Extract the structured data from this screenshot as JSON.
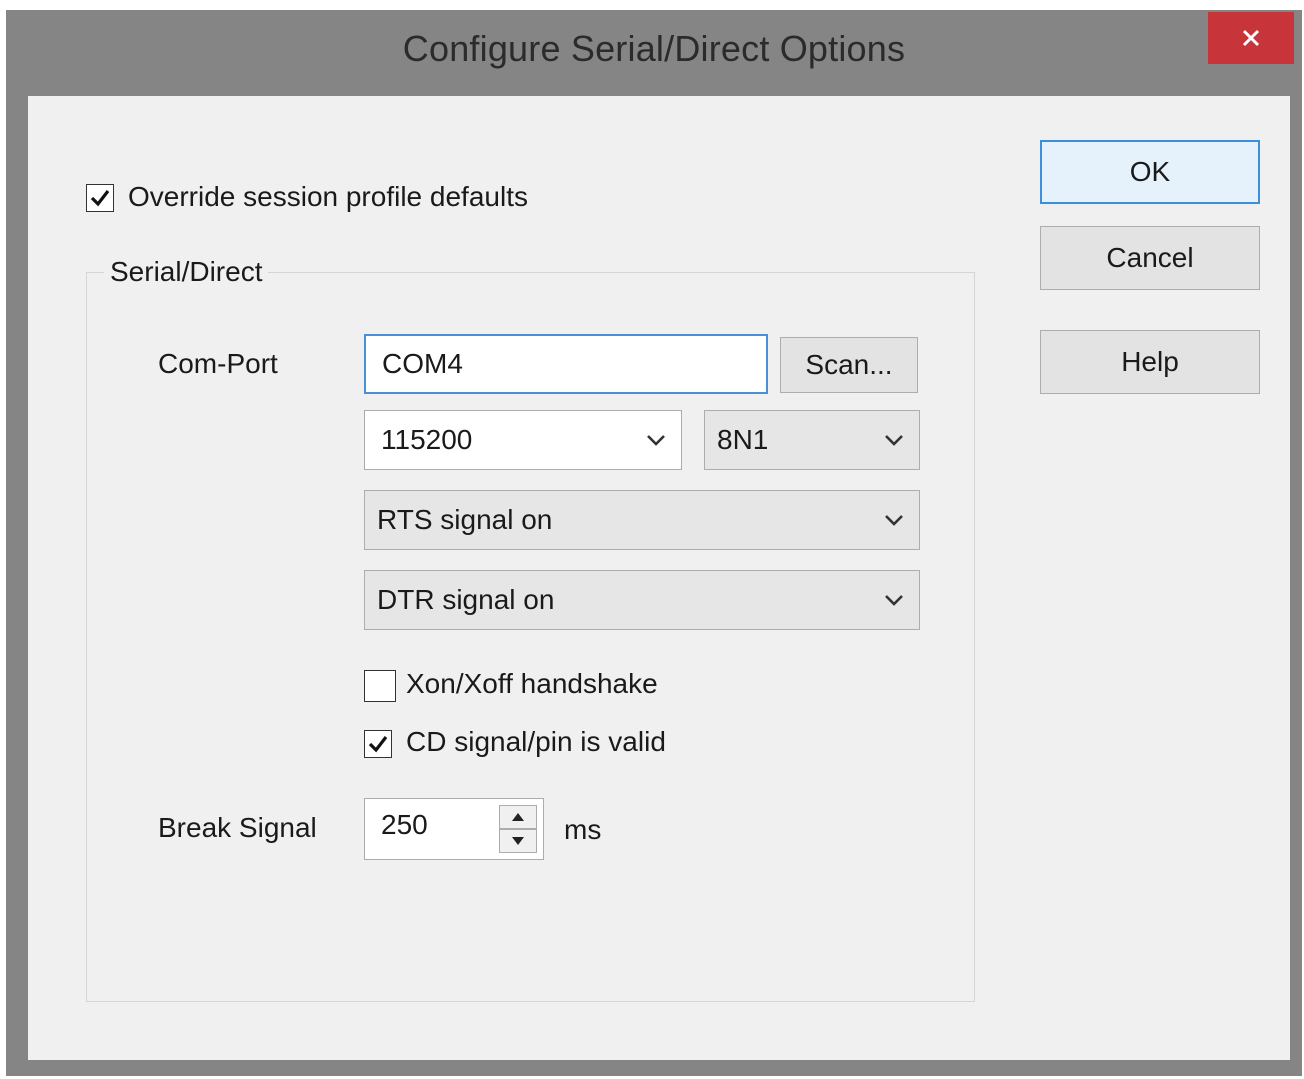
{
  "window": {
    "title": "Configure Serial/Direct Options",
    "close_icon": "close-icon"
  },
  "override": {
    "label": "Override session profile defaults",
    "checked": true
  },
  "group": {
    "title": "Serial/Direct"
  },
  "com_port": {
    "label": "Com-Port",
    "value": "COM4",
    "scan_label": "Scan..."
  },
  "baud": {
    "value": "115200"
  },
  "framing": {
    "value": "8N1"
  },
  "rts": {
    "value": "RTS signal on"
  },
  "dtr": {
    "value": "DTR signal on"
  },
  "xon_xoff": {
    "label": "Xon/Xoff handshake",
    "checked": false
  },
  "cd_signal": {
    "label": "CD signal/pin is valid",
    "checked": true
  },
  "break_signal": {
    "label": "Break Signal",
    "value": "250",
    "unit": "ms"
  },
  "buttons": {
    "ok": "OK",
    "cancel": "Cancel",
    "help": "Help"
  },
  "colors": {
    "title_bar": "#858585",
    "close_button": "#c7343a",
    "dialog_bg": "#f0f0f0",
    "focus_border": "#4a90d9"
  }
}
